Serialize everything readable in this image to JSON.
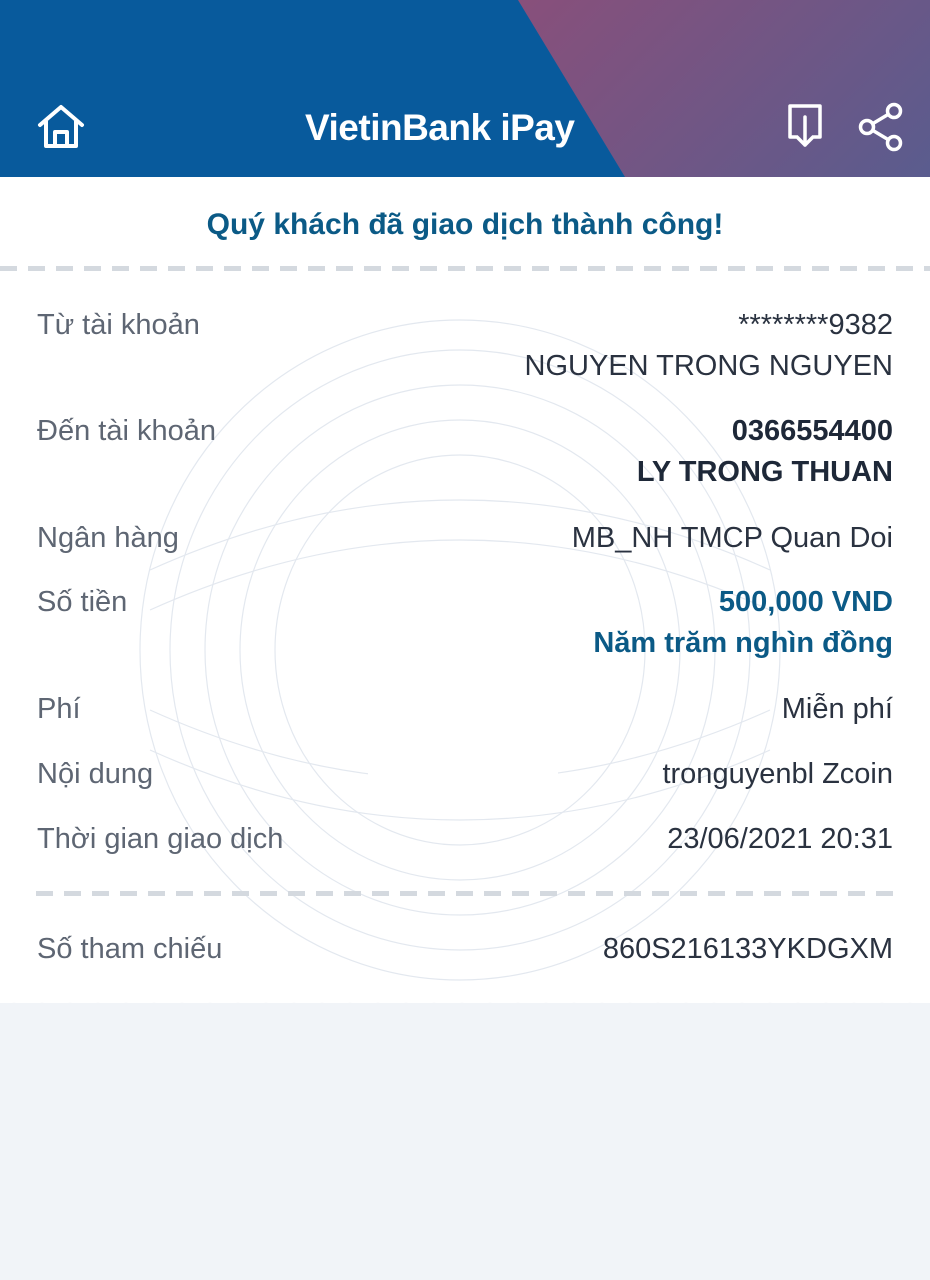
{
  "header": {
    "brand": "VietinBank iPay",
    "colors": {
      "primary": "#085a9c",
      "accent": "#b23f5b",
      "text_accent": "#0b5a86"
    },
    "icons": [
      "home-icon",
      "download-icon",
      "share-icon"
    ]
  },
  "status_message": "Quý khách đã giao dịch thành công!",
  "details": {
    "from_account": {
      "label": "Từ tài khoản",
      "number": "********9382",
      "name": "NGUYEN TRONG NGUYEN"
    },
    "to_account": {
      "label": "Đến tài khoản",
      "number": "0366554400",
      "name": "LY TRONG THUAN"
    },
    "bank": {
      "label": "Ngân hàng",
      "value": "MB_NH TMCP Quan Doi"
    },
    "amount": {
      "label": "Số tiền",
      "value": "500,000 VND",
      "in_words": "Năm trăm nghìn đồng"
    },
    "fee": {
      "label": "Phí",
      "value": "Miễn phí"
    },
    "content": {
      "label": "Nội dung",
      "value": "tronguyenbl Zcoin"
    },
    "time": {
      "label": "Thời gian giao dịch",
      "value": "23/06/2021 20:31"
    },
    "reference": {
      "label": "Số tham chiếu",
      "value": "860S216133YKDGXM"
    }
  }
}
